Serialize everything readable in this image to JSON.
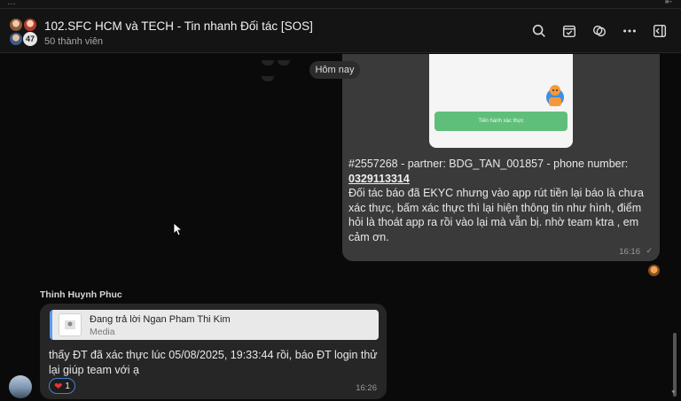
{
  "header": {
    "title": "102.SFC HCM và TECH - Tin nhanh Đối tác [SOS]",
    "member_count": "50 thành viên",
    "avatar_badge": "47",
    "icons": [
      "search-icon",
      "calendar-check-icon",
      "swirl-icon",
      "more-icon",
      "sidebar-toggle-icon"
    ]
  },
  "chat": {
    "date_separator": "Hôm nay",
    "outgoing": {
      "media_button_text": "Tiến hành xác thực",
      "lines": [
        "#2557268 - partner: BDG_TAN_001857 - phone number:",
        "Đối tác báo đã EKYC nhưng vào app rút tiền lại báo là chưa xác thực, bấm xác thực thì lại hiện thông tin như hình, điểm hỏi là thoát app ra rồi vào lại mà vẫn bị. nhờ team ktra , em cảm ơn."
      ],
      "phone": "0329113314",
      "time": "16:16"
    },
    "incoming": {
      "sender": "Thinh Huynh Phuc",
      "reply_title": "Đang trả lời Ngan Pham Thi Kim",
      "reply_subtitle": "Media",
      "text": "thấy ĐT đã xác thực lúc  05/08/2025, 19:33:44 rồi, báo ĐT login thử lại giúp team với ạ",
      "reaction_emoji": "❤",
      "reaction_count": "1",
      "time": "16:26"
    }
  }
}
